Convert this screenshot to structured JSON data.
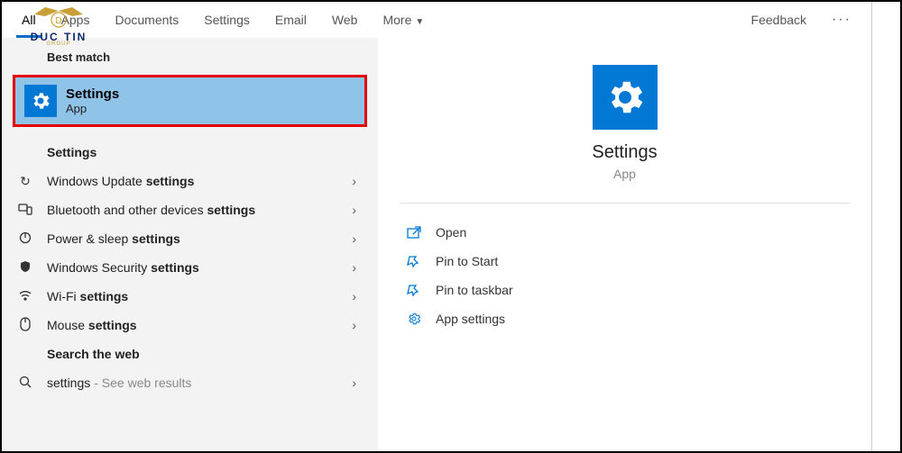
{
  "tabs": {
    "all": "All",
    "apps": "Apps",
    "documents": "Documents",
    "settings": "Settings",
    "email": "Email",
    "web": "Web",
    "more": "More"
  },
  "feedback": "Feedback",
  "bestMatchLabel": "Best match",
  "bestMatch": {
    "title": "Settings",
    "type": "App"
  },
  "settingsLabel": "Settings",
  "results": [
    {
      "prefix": "Windows Update ",
      "bold": "settings"
    },
    {
      "prefix": "Bluetooth and other devices ",
      "bold": "settings"
    },
    {
      "prefix": "Power & sleep ",
      "bold": "settings"
    },
    {
      "prefix": "Windows Security ",
      "bold": "settings"
    },
    {
      "prefix": "Wi-Fi ",
      "bold": "settings"
    },
    {
      "prefix": "Mouse ",
      "bold": "settings"
    }
  ],
  "searchWebLabel": "Search the web",
  "webResult": {
    "prefix": "settings",
    "suffix": "- See web results"
  },
  "preview": {
    "title": "Settings",
    "type": "App"
  },
  "actions": {
    "open": "Open",
    "pinStart": "Pin to Start",
    "pinTaskbar": "Pin to taskbar",
    "appSettings": "App settings"
  },
  "logo": {
    "main": "DUC TIN",
    "sub": "GROUP"
  }
}
